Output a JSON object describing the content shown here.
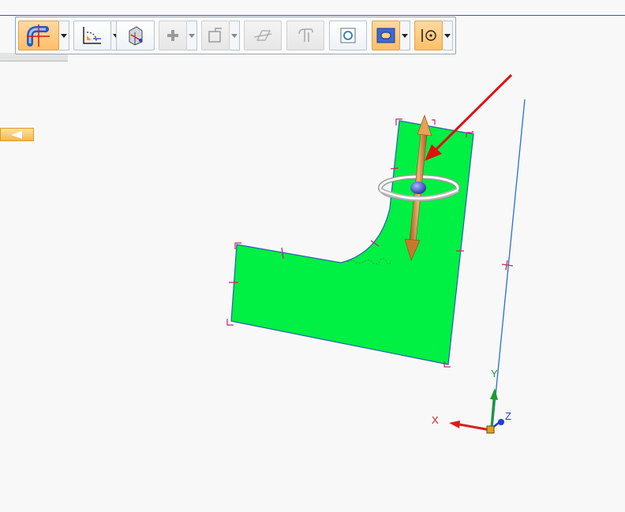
{
  "toolbar": {
    "buttons": [
      {
        "id": "bend-feature",
        "icon": "pipe-bend-icon",
        "state": "active",
        "has_dropdown": true
      },
      {
        "id": "corner-relief",
        "icon": "corner-relief-icon",
        "state": "normal",
        "has_dropdown": true
      },
      {
        "id": "measure-distance",
        "icon": "measure-distance-icon",
        "state": "normal",
        "has_dropdown": false
      },
      {
        "id": "add-keypoint",
        "icon": "plus-icon",
        "state": "disabled",
        "has_dropdown": true
      },
      {
        "id": "insert-plane",
        "icon": "plane-icon",
        "state": "disabled",
        "has_dropdown": true
      },
      {
        "id": "sketch-line",
        "icon": "sketch-line-icon",
        "state": "disabled",
        "has_dropdown": false
      },
      {
        "id": "flange-profile",
        "icon": "flange-profile-icon",
        "state": "disabled",
        "has_dropdown": false
      },
      {
        "id": "view-fit",
        "icon": "view-fit-icon",
        "state": "normal",
        "has_dropdown": false
      },
      {
        "id": "shape-select",
        "icon": "rounded-rect-icon",
        "state": "active",
        "has_dropdown": true
      },
      {
        "id": "snap-point",
        "icon": "snap-point-icon",
        "state": "active",
        "has_dropdown": true
      }
    ]
  },
  "side_panel": {
    "collapse_icon": "collapse-left-icon"
  },
  "triad": {
    "x_label": "X",
    "y_label": "Y",
    "z_label": "Z",
    "colors": {
      "x": "#d81e1e",
      "y": "#1f9a2f",
      "z": "#1f3fd0",
      "origin": "#e0a020"
    }
  },
  "model": {
    "face_color": "#00f043",
    "edge_color": "#2a5fb0",
    "handle_color": "#d4206e",
    "manipulator_color": "#d58a3c",
    "annotation_arrow_color": "#e01010",
    "axis_line_color": "#2a6fc9"
  }
}
